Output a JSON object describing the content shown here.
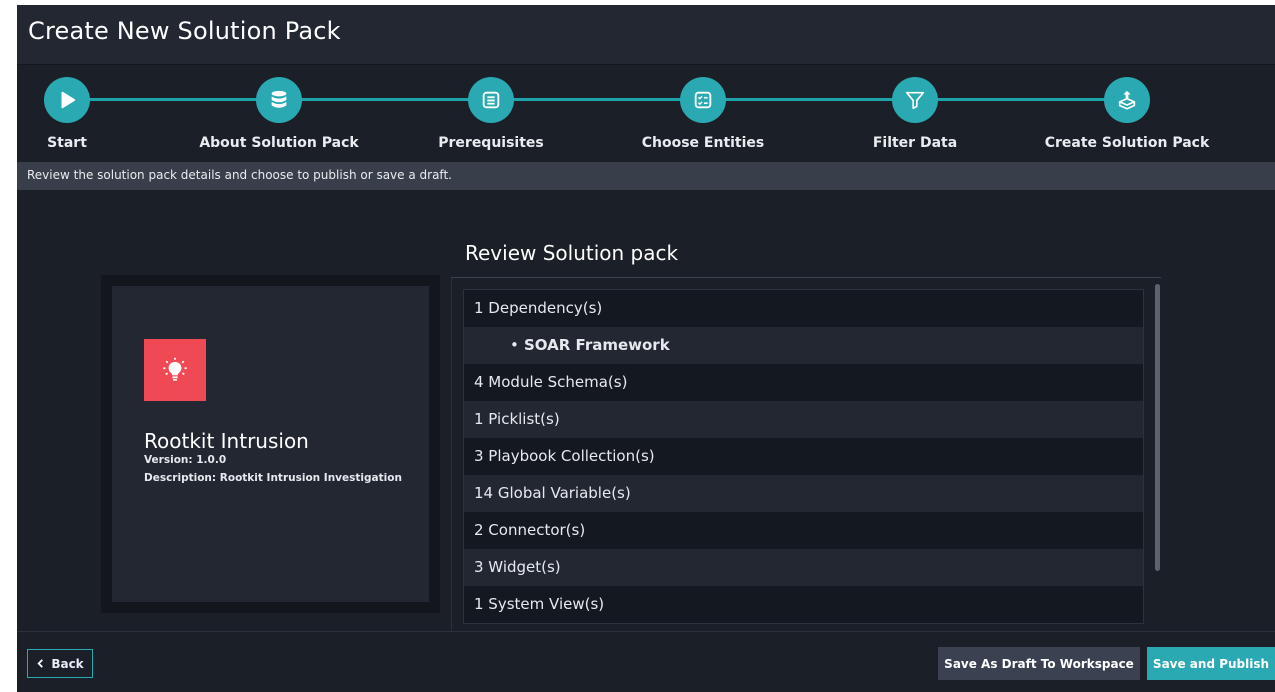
{
  "header": {
    "title": "Create New Solution Pack"
  },
  "steps": [
    {
      "label": "Start",
      "icon": "play-icon"
    },
    {
      "label": "About Solution Pack",
      "icon": "database-icon"
    },
    {
      "label": "Prerequisites",
      "icon": "list-icon"
    },
    {
      "label": "Choose Entities",
      "icon": "checklist-icon"
    },
    {
      "label": "Filter Data",
      "icon": "filter-icon"
    },
    {
      "label": "Create Solution Pack",
      "icon": "box-upload-icon"
    }
  ],
  "info_text": "Review the solution pack details and choose to publish or save a draft.",
  "pack": {
    "name": "Rootkit Intrusion",
    "version": "Version: 1.0.0",
    "description": "Description: Rootkit Intrusion Investigation",
    "icon": "lightbulb-icon"
  },
  "review": {
    "title": "Review Solution pack",
    "rows": [
      "1 Dependency(s)",
      "SOAR Framework",
      "4 Module Schema(s)",
      "1 Picklist(s)",
      "3 Playbook Collection(s)",
      "14 Global Variable(s)",
      "2 Connector(s)",
      "3 Widget(s)",
      "1 System View(s)"
    ]
  },
  "footer": {
    "back_label": "Back",
    "draft_label": "Save As Draft To Workspace",
    "publish_label": "Save and Publish"
  },
  "colors": {
    "accent": "#2aa9b2",
    "background": "#1b1f27",
    "icon_red": "#ef4a54"
  }
}
